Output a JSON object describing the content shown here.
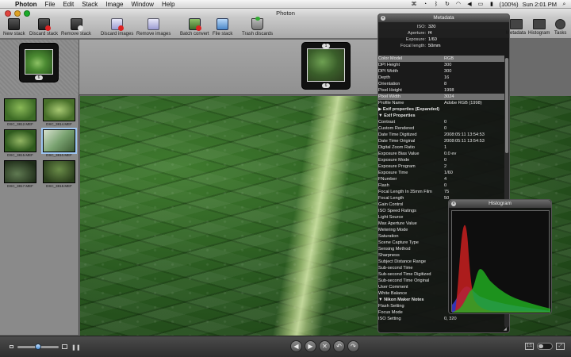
{
  "menubar": {
    "apple_glyph": "",
    "items": [
      "Photon",
      "File",
      "Edit",
      "Stack",
      "Image",
      "Window",
      "Help"
    ],
    "battery": "(100%)",
    "clock": "Sun 2:01 PM"
  },
  "window": {
    "title": "Photon"
  },
  "toolbar": {
    "new_stack": "New stack",
    "discard_stack": "Discard stack",
    "remove_stack": "Remove stack",
    "discard_images": "Discard images",
    "remove_images": "Remove images",
    "batch_convert": "Batch convert",
    "file_stack": "File stack",
    "trash_discards": "Trash discards",
    "metadata": "Metadata",
    "histogram": "Histogram",
    "tasks": "Tasks"
  },
  "filmstrip": {
    "stack_badge": "6",
    "current_badge_top": "1",
    "current_badge_bottom": "6"
  },
  "thumbnails": [
    {
      "caption": "DSC_3812.MEF"
    },
    {
      "caption": "DSC_3814.MEF"
    },
    {
      "caption": "DSC_3815.MEF"
    },
    {
      "caption": "DSC_3810.MEF"
    },
    {
      "caption": "DSC_3817.MEF"
    },
    {
      "caption": "DSC_3818.MEF"
    }
  ],
  "metadata": {
    "title": "Metadata",
    "summary": [
      {
        "k": "ISO:",
        "v": "320"
      },
      {
        "k": "Aperture:",
        "v": "f4"
      },
      {
        "k": "Exposure:",
        "v": "1/60"
      },
      {
        "k": "Focal length:",
        "v": "50mm"
      }
    ],
    "rows": [
      {
        "k": "Color Model",
        "v": "RGB",
        "type": "sel"
      },
      {
        "k": "DPI Height",
        "v": "300"
      },
      {
        "k": "DPI Width",
        "v": "300"
      },
      {
        "k": "Depth",
        "v": "16"
      },
      {
        "k": "Orientation",
        "v": "8"
      },
      {
        "k": "Pixel Height",
        "v": "1998"
      },
      {
        "k": "Pixel Width",
        "v": "3024",
        "type": "sel"
      },
      {
        "k": "Profile Name",
        "v": "Adobe RGB (1998)"
      },
      {
        "k": "▶ Exif properties (Expanded)",
        "v": "",
        "type": "section"
      },
      {
        "k": "▼ Exif Properties",
        "v": "",
        "type": "section"
      },
      {
        "k": "   Contrast",
        "v": "0"
      },
      {
        "k": "   Custom Rendered",
        "v": "0"
      },
      {
        "k": "   Date Time Digitized",
        "v": "2008:05:11 13:54:53"
      },
      {
        "k": "   Date Time Original",
        "v": "2008:05:11 13:54:53"
      },
      {
        "k": "   Digital Zoom Ratio",
        "v": "1"
      },
      {
        "k": "   Exposure Bias Value",
        "v": "0.0 ev"
      },
      {
        "k": "   Exposure Mode",
        "v": "0"
      },
      {
        "k": "   Exposure Program",
        "v": "2"
      },
      {
        "k": "   Exposure Time",
        "v": "1/60"
      },
      {
        "k": "   FNumber",
        "v": "4"
      },
      {
        "k": "   Flash",
        "v": "0"
      },
      {
        "k": "   Focal Length In 35mm Film",
        "v": "75"
      },
      {
        "k": "   Focal Length",
        "v": "50"
      },
      {
        "k": "   Gain Control",
        "v": ""
      },
      {
        "k": "   ISO Speed Ratings",
        "v": ""
      },
      {
        "k": "   Light Source",
        "v": ""
      },
      {
        "k": "   Max Aperture Value",
        "v": ""
      },
      {
        "k": "   Metering Mode",
        "v": ""
      },
      {
        "k": "   Saturation",
        "v": ""
      },
      {
        "k": "   Scene Capture Type",
        "v": ""
      },
      {
        "k": "   Sensing Method",
        "v": ""
      },
      {
        "k": "   Sharpness",
        "v": ""
      },
      {
        "k": "   Subject Distance Range",
        "v": ""
      },
      {
        "k": "   Sub-second Time",
        "v": ""
      },
      {
        "k": "   Sub-second Time Digitized",
        "v": ""
      },
      {
        "k": "   Sub-second Time Original",
        "v": ""
      },
      {
        "k": "   User Comment",
        "v": ""
      },
      {
        "k": "   White Balance",
        "v": ""
      },
      {
        "k": "▼ Nikon Maker Notes",
        "v": "",
        "type": "section"
      },
      {
        "k": "   Flash Setting",
        "v": ""
      },
      {
        "k": "   Focus Mode",
        "v": ""
      },
      {
        "k": "   ISO Setting",
        "v": "0, 320"
      }
    ]
  },
  "histogram": {
    "title": "Histogram",
    "colors": {
      "red": "#c81e1e",
      "green": "#22b422",
      "blue": "#3c3cd2"
    }
  }
}
